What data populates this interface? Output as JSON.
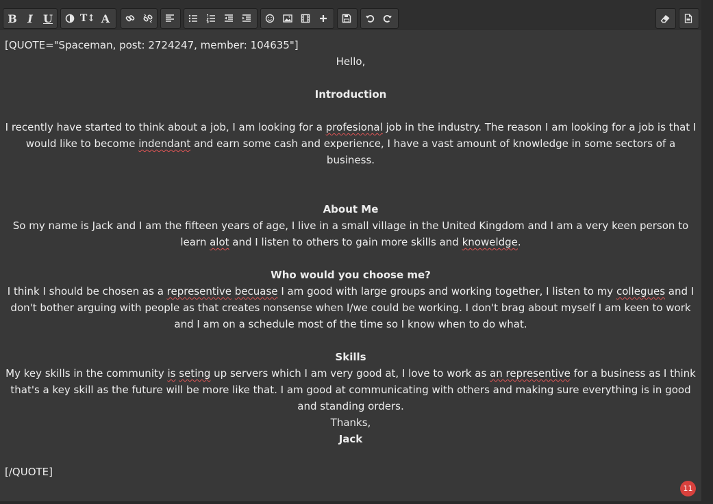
{
  "toolbar": {
    "bold_label": "B",
    "italic_label": "I",
    "underline_label": "U",
    "size_label": "T↕",
    "font_label": "A"
  },
  "content": {
    "quote_open": "[QUOTE=\"Spaceman, post: 2724247, member: 104635\"]",
    "greeting": "Hello,",
    "intro_heading": "Introduction",
    "intro_p1_a": "I recently have started to think about a job, I am looking for a ",
    "intro_sp1": "profesional",
    "intro_p1_b": " job in the industry. The reason I am looking for a job is that I would like to become ",
    "intro_sp2": "indendant",
    "intro_p1_c": " and earn some cash and experience, I have a vast amount of knowledge in some sectors of a business.",
    "about_heading": "About Me",
    "about_a": "So my name is Jack and I am the fifteen years of age, I live in a small village in the United Kingdom and I am a very keen person to learn ",
    "about_sp1": "alot",
    "about_b": " and I listen to others to gain more skills and ",
    "about_sp2": "knoweldge",
    "about_c": ".",
    "who_heading": "Who would you choose me?",
    "who_a": "I think I should be chosen as a ",
    "who_sp1": "representive",
    "who_b": " ",
    "who_sp2": "becuase",
    "who_c": " I am good with large groups and working together, I listen to my ",
    "who_sp3": "collegues",
    "who_d": " and I don't bother arguing with people as that creates nonsense when I/we could be working. I don't brag about myself I am keen to work and I am on a schedule most of the time so I know when to do what.",
    "skills_heading": "Skills",
    "skills_a": "My key skills in the community ",
    "skills_sp1": "is",
    "skills_b": " ",
    "skills_sp2": "seting",
    "skills_c": " up servers which I am very good at, I love to work as ",
    "skills_sp3": "an representive",
    "skills_d": " for a business as I think that's a key skill as the future will be more like that. I am good at communicating with others and making sure everything is in good and standing orders.",
    "thanks": "Thanks,",
    "signature": "Jack",
    "quote_close": "[/QUOTE]"
  },
  "badge": {
    "count": "11",
    "color": "#d8413d"
  }
}
